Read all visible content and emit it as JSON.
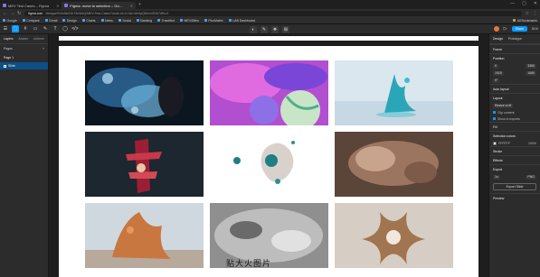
{
  "browser": {
    "tabs": [
      {
        "label": "MEV Test Cases – Figma",
        "active": false
      },
      {
        "label": "Figma: move to selection – Go…",
        "active": true
      }
    ],
    "new_tab": "+",
    "window_controls": [
      "—",
      "▢",
      "✕"
    ],
    "nav": {
      "back": "←",
      "forward": "→",
      "reload": "↻"
    },
    "url_host": "figma.com",
    "url_path": "/design/rTc9x5kG1bT3nWvQ/MEV-Test-Cases?node-id=0-1&t=Wx2pQ8vLm3Gh7dKs-0",
    "url_icons": [
      "☆",
      "⋮"
    ]
  },
  "bookmarks": {
    "items": [
      "Google",
      "Compare",
      "Gmail",
      "Design",
      "Charts",
      "News",
      "Social",
      "Banking",
      "Travelbot",
      "MEV/Sites",
      "PicoMatrix",
      "LAB Dashboard"
    ],
    "right": "All Bookmarks"
  },
  "toolbar": {
    "tools": [
      "☰",
      "⬚",
      "#",
      "▭",
      "✎",
      "T",
      "◯",
      "</>"
    ],
    "center_tools": [
      "◐",
      "✎",
      "❖",
      "⊞"
    ],
    "share_label": "Share",
    "play_icon": "▷",
    "zoom": "81%"
  },
  "left_panel": {
    "tabs": [
      "Layers",
      "Assets",
      "Actions"
    ],
    "section": "Pages",
    "add_icon": "+",
    "page_label": "Page 1",
    "layer_label": "Slide"
  },
  "canvas": {
    "caption": "贴大火图片"
  },
  "right_panel": {
    "tabs": [
      "Design",
      "Prototype"
    ],
    "frame_label": "Frame",
    "position_label": "Position",
    "x": "0",
    "y": "3360",
    "w": "1920",
    "h": "1080",
    "rotation": "0°",
    "autolayout_label": "Auto layout",
    "layout_label": "Layout",
    "layout_value": "Resize to fit",
    "clip_label": "Clip content",
    "show_in_exports": "Show in exports",
    "fill_label": "Fill",
    "selection_colors_label": "Selection colors",
    "fill_hex": "FFFFFF",
    "fill_opacity": "100%",
    "stroke_label": "Stroke",
    "effects_label": "Effects",
    "export_label": "Export",
    "export_scale": "1x",
    "export_format": "PNG",
    "export_button": "Export Slide",
    "preview_label": "Preview"
  }
}
